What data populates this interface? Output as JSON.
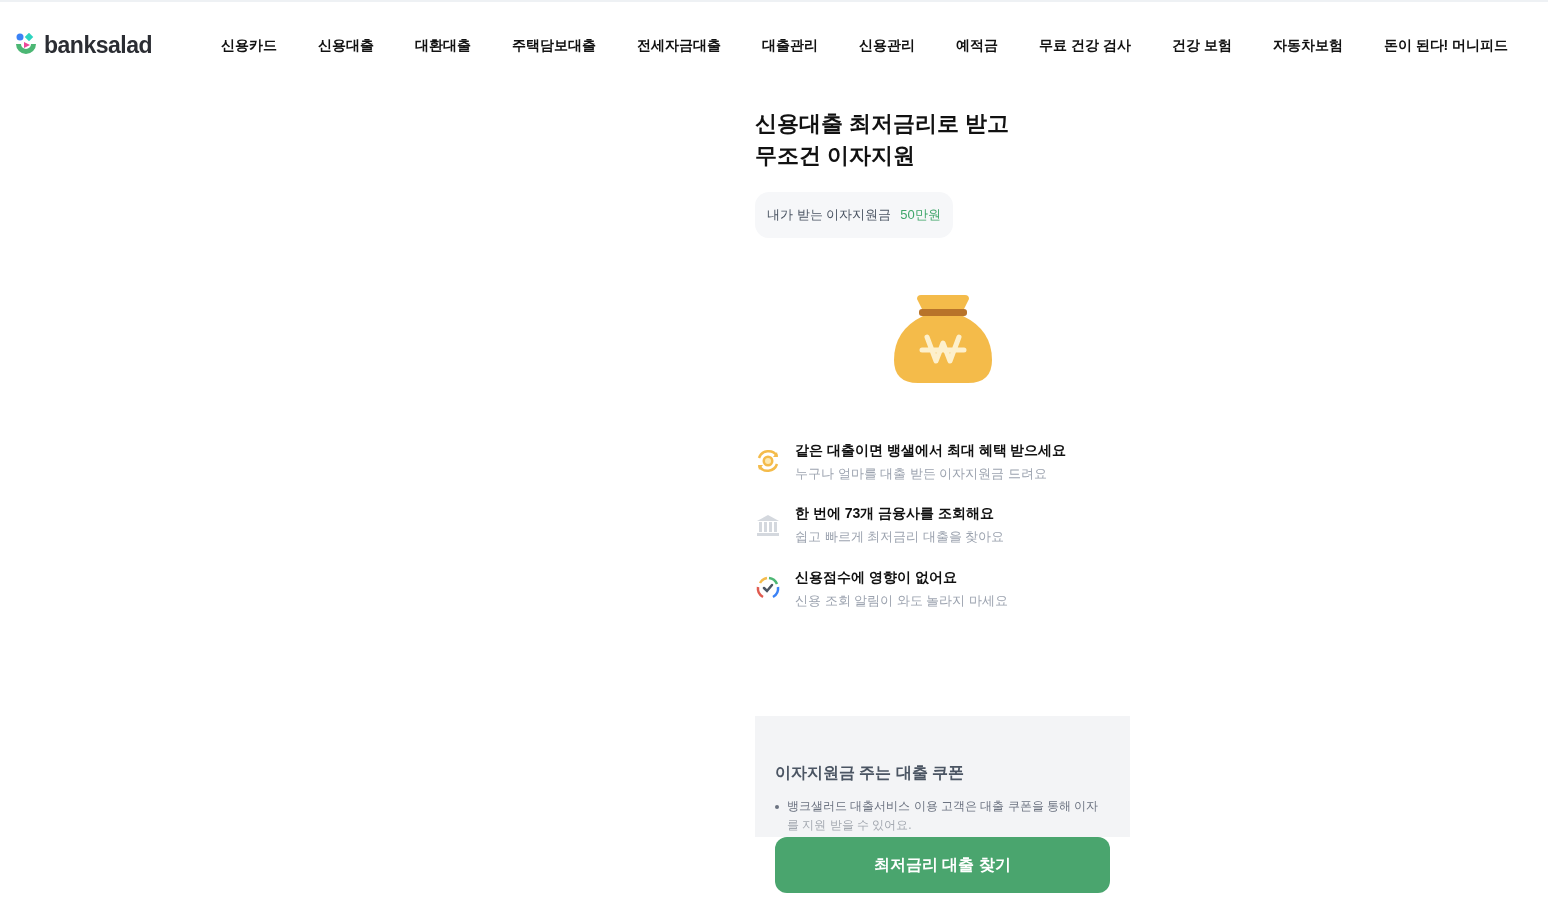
{
  "header": {
    "logo": "banksalad",
    "nav": [
      "신용카드",
      "신용대출",
      "대환대출",
      "주택담보대출",
      "전세자금대출",
      "대출관리",
      "신용관리",
      "예적금",
      "무료 건강 검사",
      "건강 보험",
      "자동차보험",
      "돈이 된다! 머니피드"
    ]
  },
  "hero": {
    "title_lines": [
      "신용대출 최저금리로 받고",
      "무조건 이자지원"
    ],
    "support_label": "내가 받는 이자지원금",
    "support_amount": "50만원"
  },
  "features": [
    {
      "kind": "coin",
      "title": "같은 대출이면 뱅샐에서 최대 혜택 받으세요",
      "subtitle": "누구나 얼마를 대출 받든 이자지원금 드려요"
    },
    {
      "kind": "bank",
      "title": "한 번에 73개 금융사를 조회해요",
      "subtitle": "쉽고 빠르게 최저금리 대출을 찾아요"
    },
    {
      "kind": "check",
      "title": "신용점수에 영향이 없어요",
      "subtitle": "신용 조회 알림이 와도 놀라지 마세요"
    }
  ],
  "coupon": {
    "title": "이자지원금 주는 대출 쿠폰",
    "bullet_lines": [
      "뱅크샐러드 대출서비스 이용 고객은 대출 쿠폰을 통해 이자",
      "를 지원 받을 수 있어요."
    ]
  },
  "cta": "최저금리 대출 찾기"
}
